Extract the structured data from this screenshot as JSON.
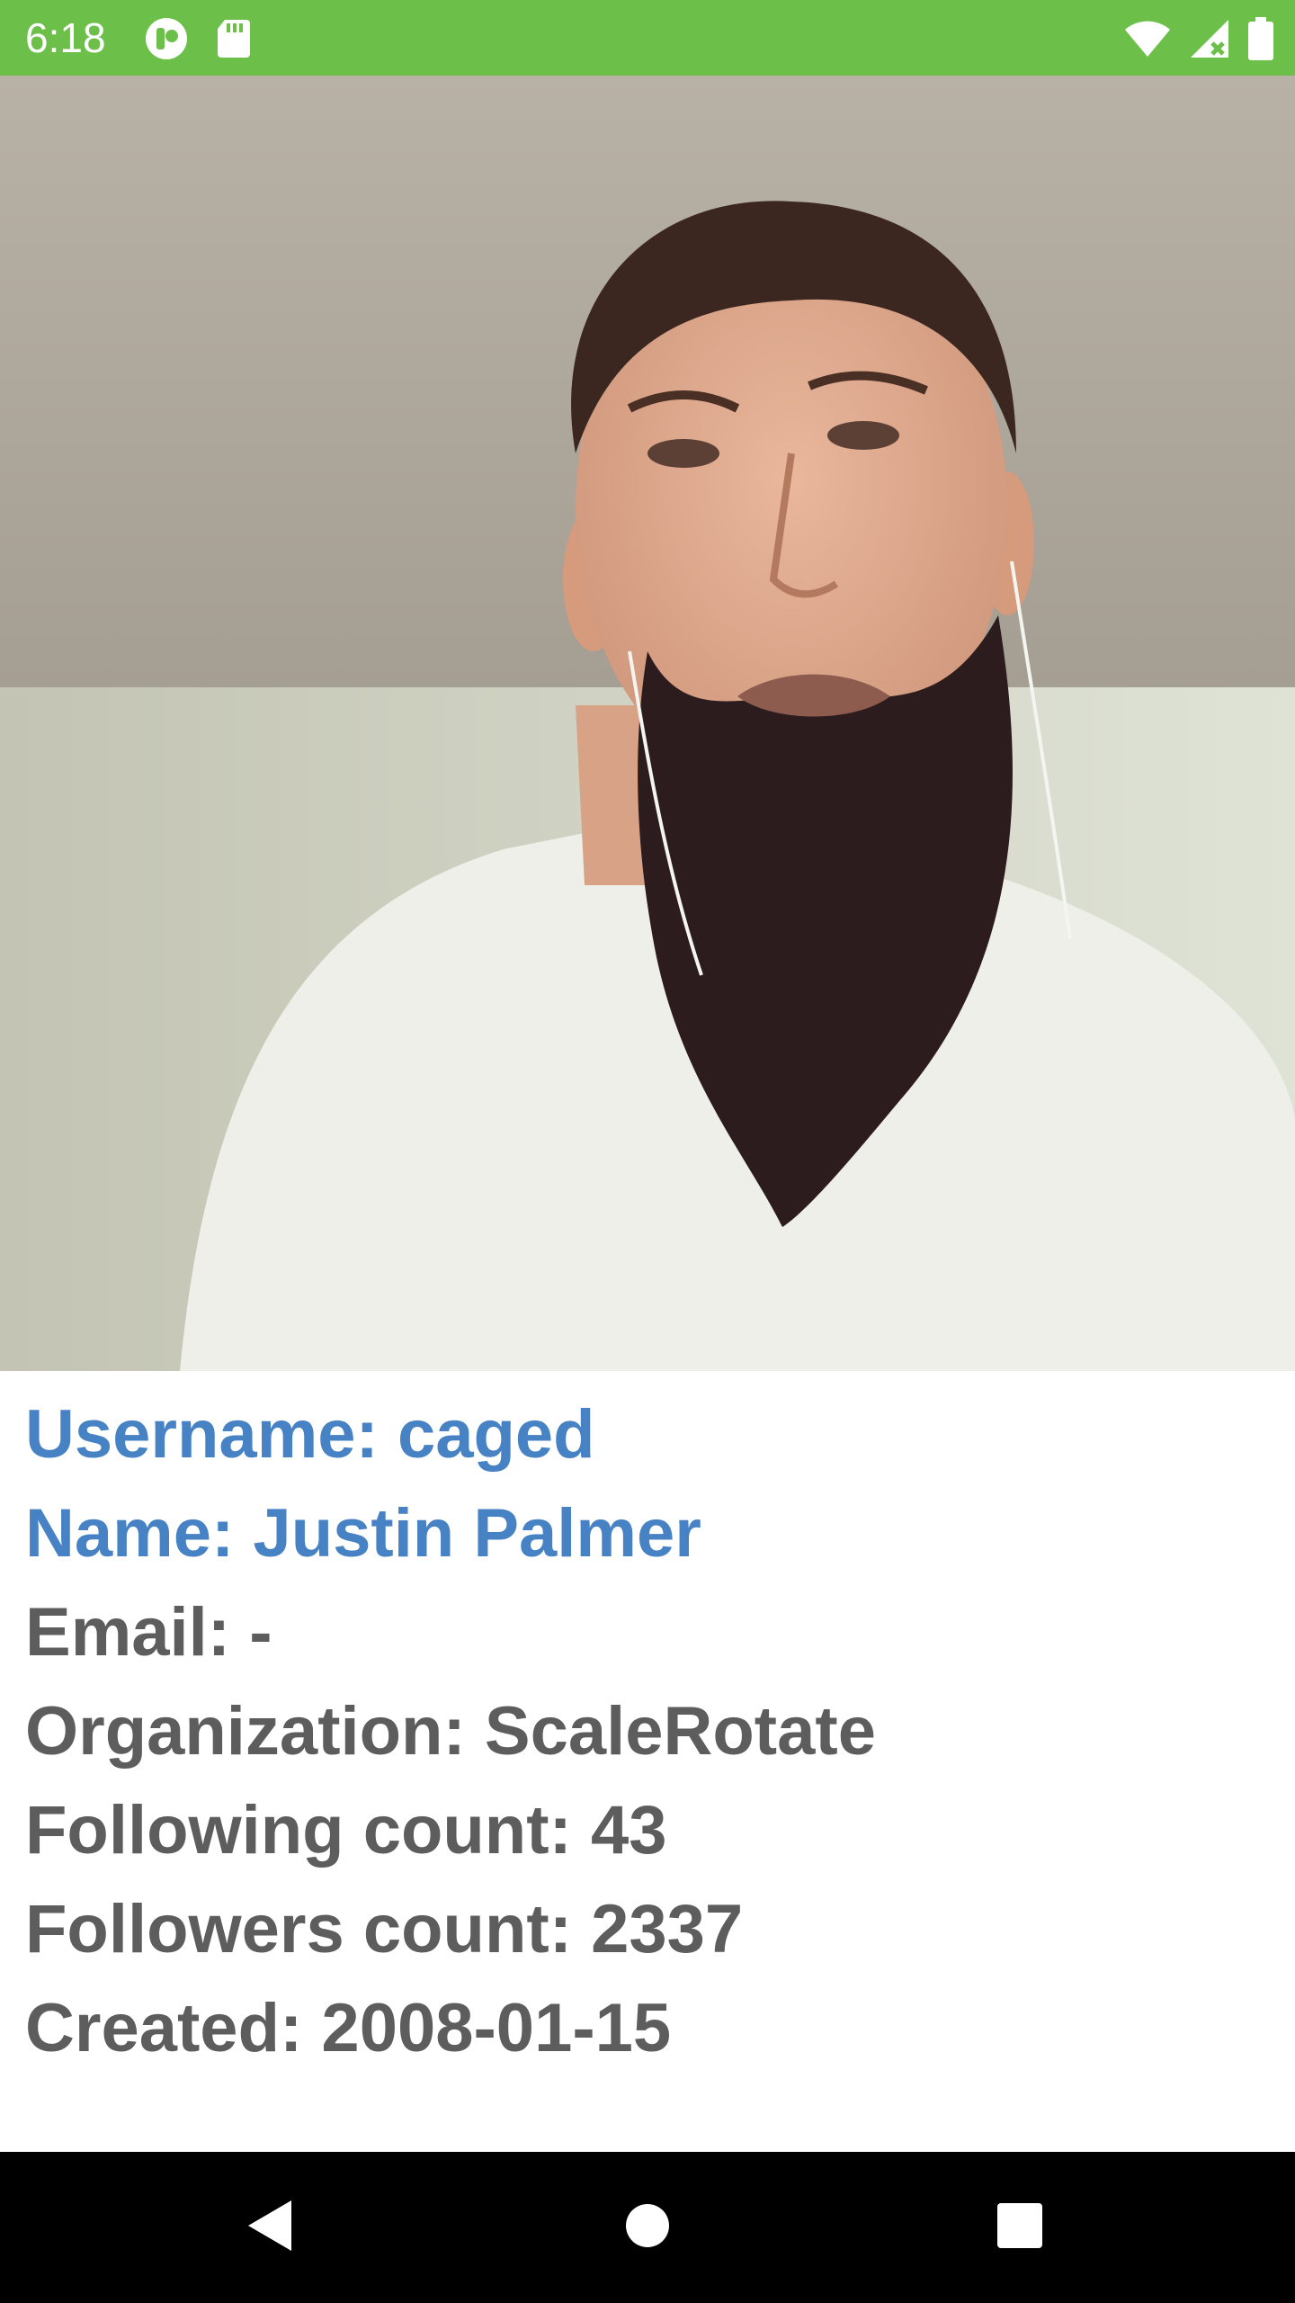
{
  "status_bar": {
    "time": "6:18",
    "background": "#6cc04a",
    "left_icons": [
      "notification-app-icon",
      "sd-card-icon"
    ],
    "right_icons": [
      "wifi-icon",
      "cellular-signal-icon",
      "battery-icon"
    ]
  },
  "profile": {
    "avatar_icon": "profile-photo",
    "username": "Username: caged",
    "name": "Name: Justin Palmer",
    "email": "Email: -",
    "organization": "Organization: ScaleRotate",
    "following": "Following count: 43",
    "followers": "Followers count: 2337",
    "created": "Created: 2008-01-15"
  },
  "colors": {
    "accent": "#4682c4",
    "text": "#5d5d5d"
  },
  "nav_bar": {
    "buttons": [
      "back-icon",
      "home-icon",
      "recents-icon"
    ]
  }
}
